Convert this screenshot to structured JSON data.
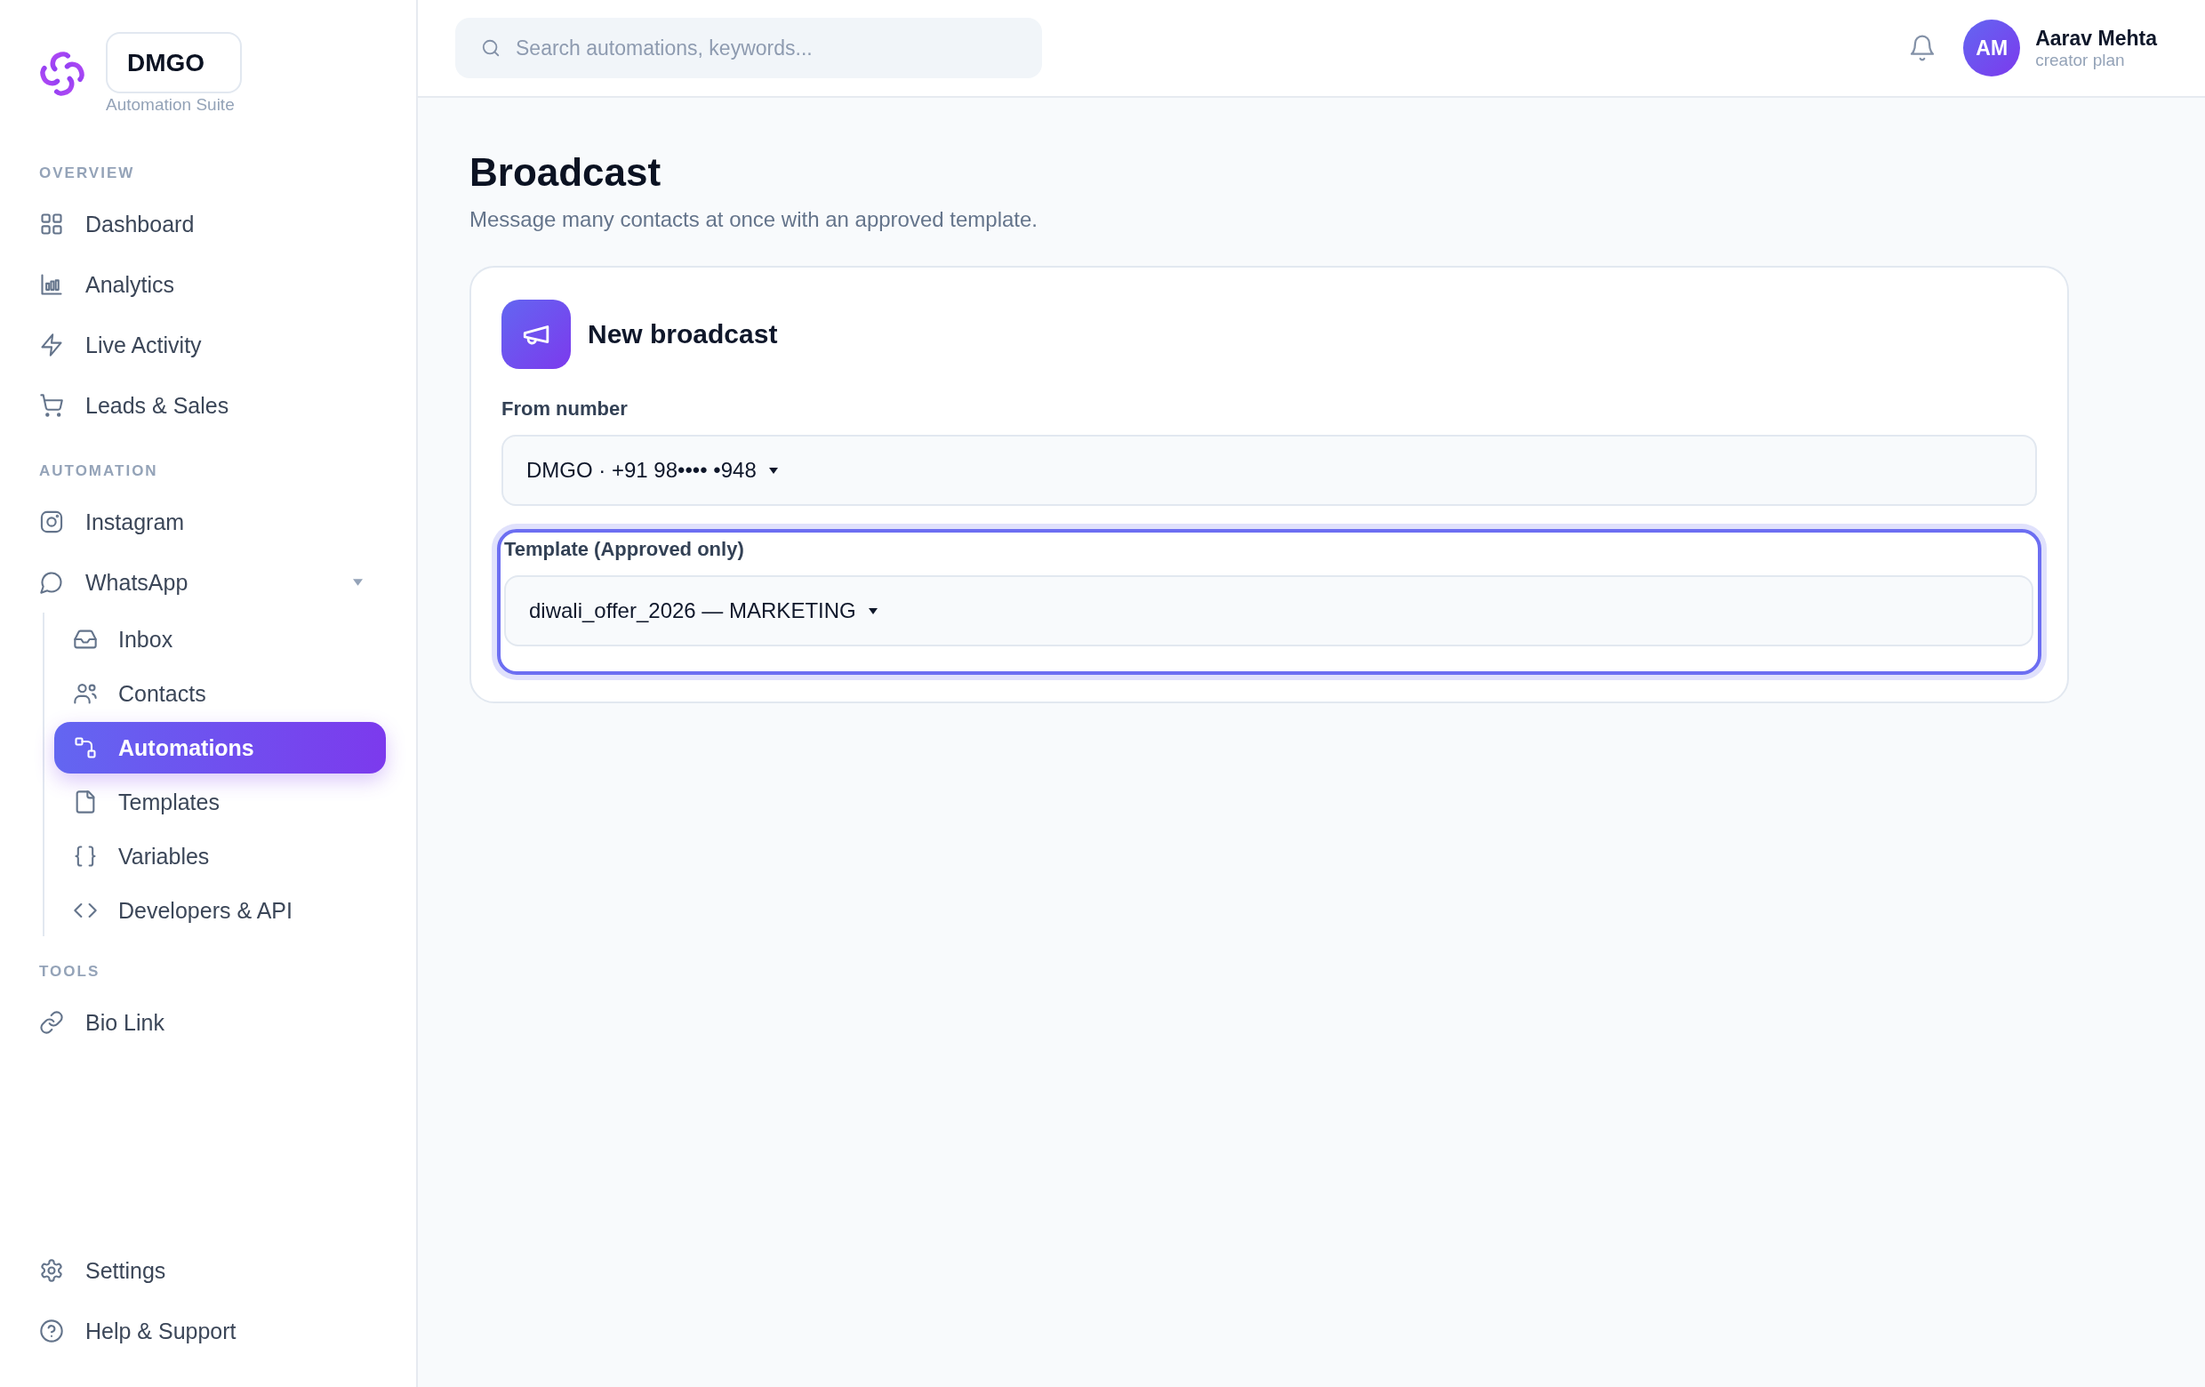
{
  "sidebar": {
    "brand": {
      "name": "DMGO",
      "tagline": "Automation Suite"
    },
    "sections": [
      {
        "title": "OVERVIEW",
        "items": [
          {
            "label": "Dashboard",
            "selected": false
          },
          {
            "label": "Analytics",
            "selected": false
          },
          {
            "label": "Live Activity",
            "selected": false
          },
          {
            "label": "Leads & Sales",
            "selected": false
          }
        ]
      },
      {
        "title": "AUTOMATION",
        "items": [
          {
            "label": "Instagram",
            "selected": false
          },
          {
            "label": "WhatsApp",
            "selected": false,
            "expanded": true,
            "children": [
              {
                "label": "Inbox",
                "selected": false
              },
              {
                "label": "Contacts",
                "selected": false
              },
              {
                "label": "Automations",
                "selected": true
              },
              {
                "label": "Templates",
                "selected": false
              },
              {
                "label": "Variables",
                "selected": false
              },
              {
                "label": "Developers & API",
                "selected": false
              }
            ]
          }
        ]
      },
      {
        "title": "TOOLS",
        "items": [
          {
            "label": "Bio Link",
            "selected": false
          }
        ]
      }
    ],
    "footer_items": [
      {
        "label": "Settings",
        "selected": false
      },
      {
        "label": "Help & Support",
        "selected": false
      }
    ]
  },
  "header": {
    "search": {
      "placeholder": "Search automations, keywords..."
    },
    "user": {
      "initials": "AM",
      "name": "Aarav Mehta",
      "plan": "creator plan"
    }
  },
  "page": {
    "title": "Broadcast",
    "subtitle": "Message many contacts at once with an approved template."
  },
  "card": {
    "title": "New broadcast",
    "fields": [
      {
        "label": "From number",
        "value": "DMGO · +91 98•••• •948",
        "focused": false
      },
      {
        "label": "Template (Approved only)",
        "value": "diwali_offer_2026 — MARKETING",
        "focused": true
      }
    ]
  }
}
